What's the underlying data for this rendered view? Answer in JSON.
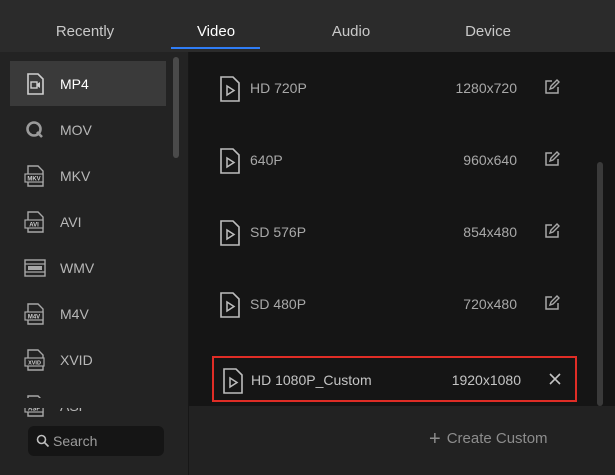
{
  "tabs": [
    {
      "label": "Recently"
    },
    {
      "label": "Video"
    },
    {
      "label": "Audio"
    },
    {
      "label": "Device"
    }
  ],
  "active_tab": "Video",
  "formats": [
    {
      "label": "MP4",
      "icon": "mp4-video-icon",
      "selected": true
    },
    {
      "label": "MOV",
      "icon": "quicktime-icon"
    },
    {
      "label": "MKV",
      "icon": "mkv-file-icon",
      "icon_text": "MKV"
    },
    {
      "label": "AVI",
      "icon": "avi-file-icon",
      "icon_text": "AVI"
    },
    {
      "label": "WMV",
      "icon": "wmv-icon"
    },
    {
      "label": "M4V",
      "icon": "m4v-file-icon",
      "icon_text": "M4V"
    },
    {
      "label": "XVID",
      "icon": "xvid-file-icon",
      "icon_text": "XVID"
    },
    {
      "label": "ASF",
      "icon": "asf-file-icon",
      "icon_text": "ASF"
    }
  ],
  "search": {
    "placeholder": "Search"
  },
  "presets": [
    {
      "name": "HD 720P",
      "resolution": "1280x720",
      "action": "edit-icon"
    },
    {
      "name": "640P",
      "resolution": "960x640",
      "action": "edit-icon"
    },
    {
      "name": "SD 576P",
      "resolution": "854x480",
      "action": "edit-icon"
    },
    {
      "name": "SD 480P",
      "resolution": "720x480",
      "action": "edit-icon"
    }
  ],
  "custom_preset": {
    "name": "HD 1080P_Custom",
    "resolution": "1920x1080",
    "action": "close-icon",
    "highlight_color": "#e02d26"
  },
  "create_custom": {
    "label": "Create Custom"
  },
  "colors": {
    "accent": "#2f7df6",
    "highlight": "#e02d26"
  }
}
